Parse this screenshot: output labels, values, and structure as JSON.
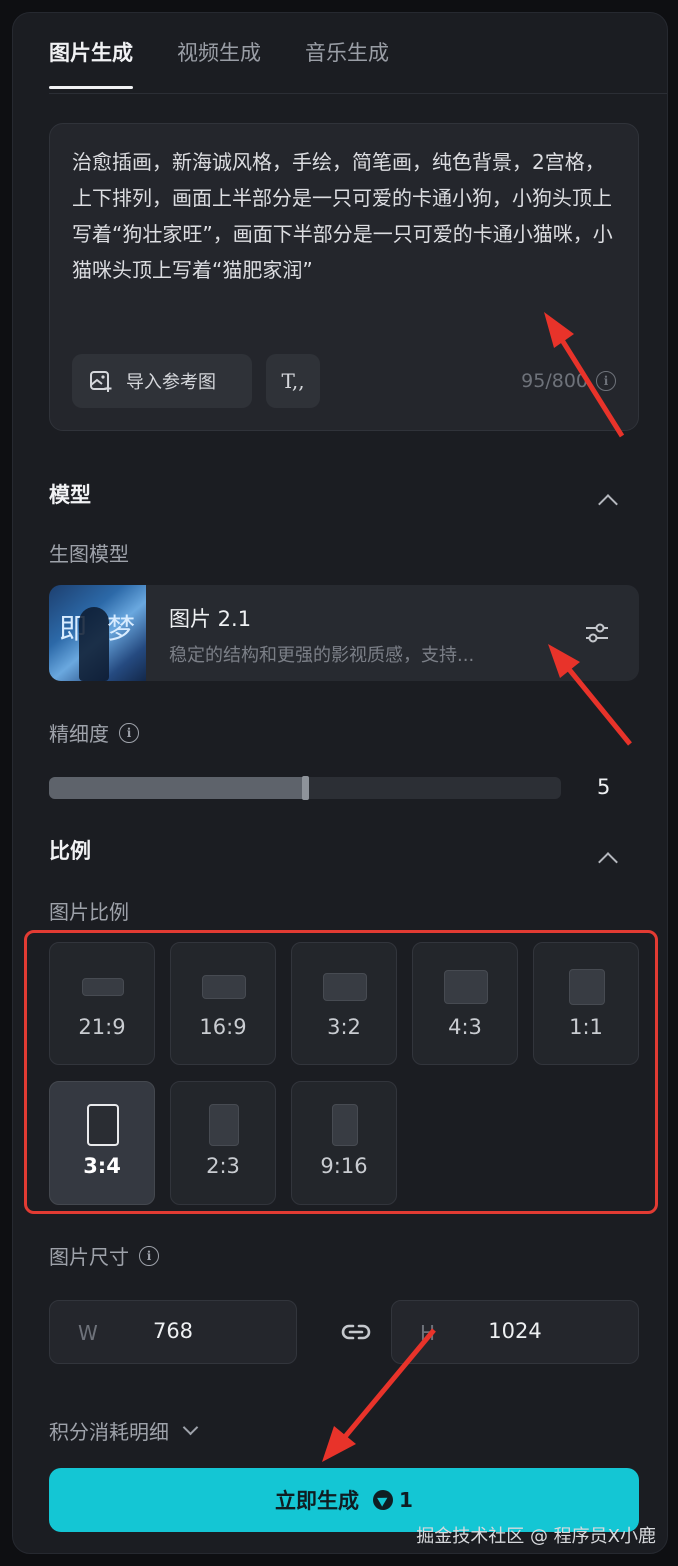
{
  "tabs": [
    {
      "label": "图片生成",
      "active": true
    },
    {
      "label": "视频生成",
      "active": false
    },
    {
      "label": "音乐生成",
      "active": false
    }
  ],
  "prompt": {
    "text": "治愈插画，新海诚风格，手绘，简笔画，纯色背景，2宫格，上下排列，画面上半部分是一只可爱的卡通小狗，小狗头顶上写着“狗壮家旺”，画面下半部分是一只可爱的卡通小猫咪，小猫咪头顶上写着“猫肥家润”",
    "import_ref_label": "导入参考图",
    "text_tool_label": "T,,",
    "counter": "95/800"
  },
  "model_section": {
    "title": "模型",
    "sub_label": "生图模型",
    "model_name": "图片 2.1",
    "model_desc": "稳定的结构和更强的影视质感，支持...",
    "thumb_glyphs": [
      "即",
      "梦"
    ]
  },
  "detail": {
    "label": "精细度",
    "value": "5",
    "level_fraction": 0.5
  },
  "ratio_section": {
    "title": "比例",
    "sub_label": "图片比例",
    "options": [
      "21:9",
      "16:9",
      "3:2",
      "4:3",
      "1:1",
      "3:4",
      "2:3",
      "9:16"
    ],
    "selected": "3:4"
  },
  "size": {
    "label": "图片尺寸",
    "width_prefix": "W",
    "width": "768",
    "height_prefix": "H",
    "height": "1024"
  },
  "cost_label": "积分消耗明细",
  "generate": {
    "label": "立即生成",
    "credits": "1"
  },
  "watermark": "掘金技术社区 @ 程序员X小鹿",
  "colors": {
    "accent": "#14c6d4",
    "highlight": "#e23b33",
    "panel": "#1b1d22"
  }
}
